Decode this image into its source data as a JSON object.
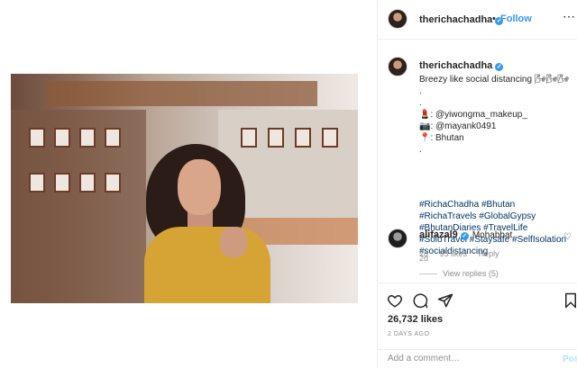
{
  "header": {
    "username": "therichachadha",
    "separator": "•",
    "follow_label": "Follow",
    "more_label": "•••"
  },
  "caption": {
    "username": "therichachadha",
    "text": "Breezy like social distancing 🌬🌬🌬\n.\n.\n💄: @yiwongma_makeup_\n📷: @mayank0491\n📍: Bhutan\n.",
    "tags": [
      "#RichaChadha",
      "#Bhutan",
      "#RichaTravels",
      "#GlobalGypsy",
      "#BhutanDiaries",
      "#TravelLife",
      "#SoloTravel",
      "#Staysafe",
      "#SelfIsolation",
      "#socialdistancing"
    ],
    "time": "2d"
  },
  "comment": {
    "username": "alifazal9",
    "text": "Mohabbat",
    "time": "2d",
    "likes": "95 likes",
    "reply_label": "Reply",
    "view_replies": "View replies (5)"
  },
  "actions": {
    "likes": "26,732 likes",
    "date": "2 DAYS AGO"
  },
  "add_comment": {
    "placeholder": "Add a comment…",
    "post_label": "Post"
  },
  "colors": {
    "link": "#3897f0",
    "hashtag": "#003569",
    "muted": "#8e8e8e"
  },
  "icons": [
    "verified-badge-icon",
    "heart-icon",
    "comment-icon",
    "share-icon",
    "bookmark-icon",
    "more-icon"
  ]
}
